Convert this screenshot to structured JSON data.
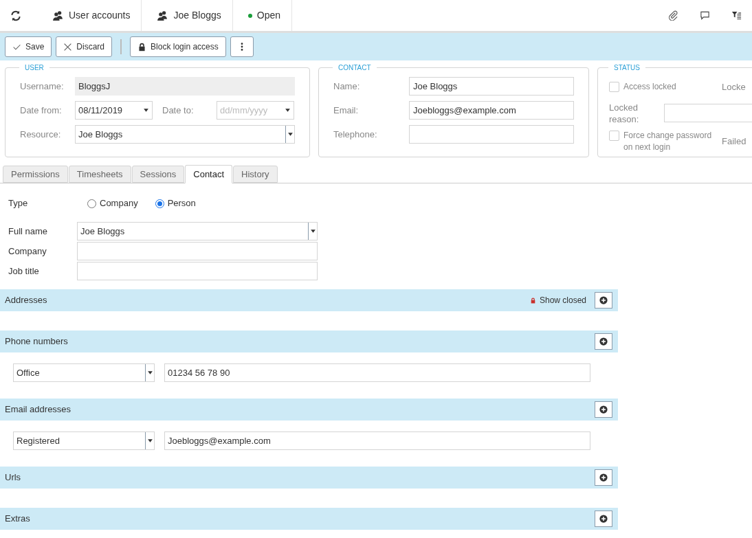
{
  "breadcrumbs": [
    {
      "kind": "refresh"
    },
    {
      "kind": "users",
      "label": "User accounts"
    },
    {
      "kind": "user",
      "label": "Joe Bloggs"
    },
    {
      "kind": "status",
      "label": "Open"
    }
  ],
  "header_actions": [
    {
      "kind": "attach"
    },
    {
      "kind": "comment"
    },
    {
      "kind": "filter"
    }
  ],
  "toolbar": [
    {
      "kind": "save",
      "label": "Save"
    },
    {
      "kind": "discard",
      "label": "Discard"
    },
    {
      "kind": "lock",
      "label": "Block login access"
    },
    {
      "kind": "more"
    }
  ],
  "user": {
    "legend": "USER",
    "username_label": "Username:",
    "username": "BloggsJ",
    "date_from_label": "Date from:",
    "date_from": "08/11/2019",
    "date_to_label": "Date to:",
    "date_to_placeholder": "dd/mm/yyyy",
    "resource_label": "Resource:",
    "resource": "Joe Bloggs"
  },
  "contact": {
    "legend": "CONTACT",
    "fields": [
      {
        "label": "Name:",
        "value": "Joe Bloggs"
      },
      {
        "label": "Email:",
        "value": "Joebloggs@example.com"
      },
      {
        "label": "Telephone:"
      }
    ]
  },
  "status": {
    "legend": "STATUS",
    "access_locked": {
      "label": "Access locked",
      "checked": false
    },
    "column_2_top": "Locke",
    "locked_reason_label": "Locked reason:",
    "force_change": {
      "label": "Force change password on next login",
      "checked": false
    },
    "column_2_bottom": "Failed"
  },
  "tabs": [
    {
      "label": "Permissions",
      "selected": false
    },
    {
      "label": "Timesheets",
      "selected": false
    },
    {
      "label": "Sessions",
      "selected": false
    },
    {
      "label": "Contact",
      "selected": true
    },
    {
      "label": "History",
      "selected": false
    }
  ],
  "contact_form": {
    "type_label": "Type",
    "type_options": [
      {
        "label": "Company",
        "selected": false
      },
      {
        "label": "Person",
        "selected": true
      }
    ],
    "fields": [
      {
        "kind": "dropdown",
        "label": "Full name",
        "value": "Joe Bloggs"
      },
      {
        "kind": "text",
        "label": "Company"
      },
      {
        "kind": "text",
        "label": "Job title"
      }
    ]
  },
  "sections": [
    {
      "title": "Addresses",
      "show_closed": "Show closed"
    },
    {
      "title": "Phone numbers",
      "rows": [
        {
          "type": "Office",
          "value": "01234 56 78 90"
        }
      ]
    },
    {
      "title": "Email addresses",
      "rows": [
        {
          "type": "Registered",
          "value": "Joebloggs@example.com"
        }
      ]
    },
    {
      "title": "Urls"
    },
    {
      "title": "Extras"
    }
  ]
}
